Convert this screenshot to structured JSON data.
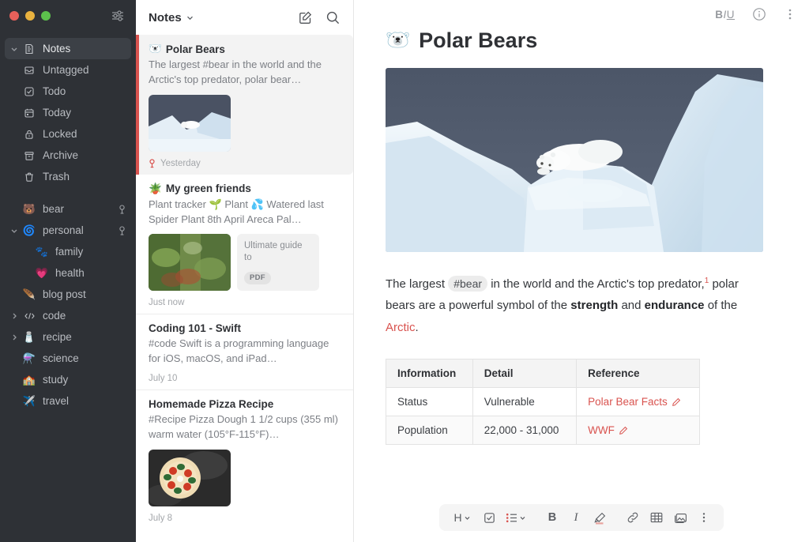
{
  "window": {
    "traffic_lights": [
      {
        "name": "close",
        "color": "#e8605a"
      },
      {
        "name": "minimize",
        "color": "#e9b23f"
      },
      {
        "name": "zoom",
        "color": "#5cc04c"
      }
    ],
    "filter_icon": "sliders-icon"
  },
  "sidebar": {
    "background": "#2e3136",
    "items": [
      {
        "label": "Notes",
        "icon": "note-icon",
        "indent": 0,
        "chevron": "down",
        "selected": true,
        "pinned": false
      },
      {
        "label": "Untagged",
        "icon": "inbox-icon",
        "indent": 1,
        "chevron": "",
        "selected": false,
        "pinned": false
      },
      {
        "label": "Todo",
        "icon": "checkbox-icon",
        "indent": 1,
        "chevron": "",
        "selected": false,
        "pinned": false
      },
      {
        "label": "Today",
        "icon": "calendar-icon",
        "indent": 1,
        "chevron": "",
        "selected": false,
        "pinned": false
      },
      {
        "label": "Locked",
        "icon": "lock-icon",
        "indent": 1,
        "chevron": "",
        "selected": false,
        "pinned": false
      },
      {
        "label": "Archive",
        "icon": "archive-icon",
        "indent": 1,
        "chevron": "",
        "selected": false,
        "pinned": false
      },
      {
        "label": "Trash",
        "icon": "trash-icon",
        "indent": 1,
        "chevron": "",
        "selected": false,
        "pinned": false
      }
    ],
    "tags": [
      {
        "label": "bear",
        "emoji": "🐻",
        "indent": 0,
        "chevron": "",
        "pinned": true
      },
      {
        "label": "personal",
        "emoji": "🌀",
        "indent": 0,
        "chevron": "down",
        "pinned": true
      },
      {
        "label": "family",
        "emoji": "🐾",
        "indent": 1,
        "chevron": "",
        "pinned": false
      },
      {
        "label": "health",
        "emoji": "💗",
        "indent": 1,
        "chevron": "",
        "pinned": false
      },
      {
        "label": "blog post",
        "emoji": "🪶",
        "indent": 0,
        "chevron": "",
        "pinned": false
      },
      {
        "label": "code",
        "emoji": "",
        "indent": 0,
        "chevron": "right",
        "pinned": false,
        "icon": "code-icon"
      },
      {
        "label": "recipe",
        "emoji": "🧂",
        "indent": 0,
        "chevron": "right",
        "pinned": false
      },
      {
        "label": "science",
        "emoji": "⚗️",
        "indent": 0,
        "chevron": "",
        "pinned": false
      },
      {
        "label": "study",
        "emoji": "🏫",
        "indent": 0,
        "chevron": "",
        "pinned": false
      },
      {
        "label": "travel",
        "emoji": "✈️",
        "indent": 0,
        "chevron": "",
        "pinned": false
      }
    ]
  },
  "notelist": {
    "title": "Notes",
    "title_chevron": "chevron-down-icon",
    "compose_icon": "compose-icon",
    "search_icon": "search-icon",
    "notes": [
      {
        "emoji": "🐻‍❄️",
        "title": "Polar Bears",
        "preview": "The largest #bear in the world and the Arctic's top predator, polar bear…",
        "meta": "Yesterday",
        "pinned": true,
        "selected": true,
        "thumb": "polar-bear-photo",
        "attachment": null
      },
      {
        "emoji": "🪴",
        "title": "My green friends",
        "preview": "Plant tracker 🌱 Plant 💦 Watered last Spider Plant 8th April Areca Pal…",
        "meta": "Just now",
        "pinned": false,
        "selected": false,
        "thumb": "plants-photo",
        "attachment": {
          "title": "Ultimate guide to",
          "badge": "PDF"
        }
      },
      {
        "emoji": "",
        "title": "Coding 101 - Swift",
        "preview": "#code Swift is a programming language for iOS, macOS, and iPad…",
        "meta": "July 10",
        "pinned": false,
        "selected": false,
        "thumb": null,
        "attachment": null
      },
      {
        "emoji": "",
        "title": "Homemade Pizza Recipe",
        "preview": "#Recipe Pizza Dough 1 1/2 cups (355 ml) warm water (105°F-115°F)…",
        "meta": "July 8",
        "pinned": false,
        "selected": false,
        "thumb": "pizza-photo",
        "attachment": null
      }
    ]
  },
  "editor": {
    "toolbar": {
      "style_label_b": "B",
      "style_label_i": "I",
      "style_label_u": "U",
      "info_icon": "info-icon",
      "more_icon": "more-vertical-icon"
    },
    "title_emoji": "🐻‍❄️",
    "title": "Polar Bears",
    "hero_image": "polar-bear-on-ice-photo",
    "paragraph": {
      "p1": "The largest",
      "tag": "#bear",
      "p2": "in the world and the Arctic's top predator,",
      "footnote": "1",
      "p3": "polar bears are a powerful symbol of the",
      "bold1": "strength",
      "p4": "and",
      "bold2": "endurance",
      "p5": "of the",
      "link": "Arctic",
      "p6": "."
    },
    "table": {
      "headers": [
        "Information",
        "Detail",
        "Reference"
      ],
      "rows": [
        {
          "information": "Status",
          "detail": "Vulnerable",
          "reference": "Polar Bear Facts"
        },
        {
          "information": "Population",
          "detail": "22,000 - 31,000",
          "reference": "WWF"
        }
      ]
    },
    "format_bar": [
      {
        "name": "heading-dropdown",
        "label": "H",
        "chevron": true
      },
      {
        "name": "checklist-icon",
        "label": "",
        "chevron": false
      },
      {
        "name": "list-dropdown",
        "label": "",
        "chevron": true
      },
      {
        "name": "bold-button",
        "label": "B",
        "chevron": false
      },
      {
        "name": "italic-button",
        "label": "I",
        "chevron": false
      },
      {
        "name": "highlight-icon",
        "label": "",
        "chevron": false
      },
      {
        "name": "link-icon",
        "label": "",
        "chevron": false
      },
      {
        "name": "table-icon",
        "label": "",
        "chevron": false
      },
      {
        "name": "image-icon",
        "label": "",
        "chevron": false
      },
      {
        "name": "more-vertical-icon",
        "label": "",
        "chevron": false
      }
    ]
  },
  "colors": {
    "accent_red": "#d9534f",
    "sidebar_bg": "#2e3136",
    "selected_row": "#3c4046"
  }
}
